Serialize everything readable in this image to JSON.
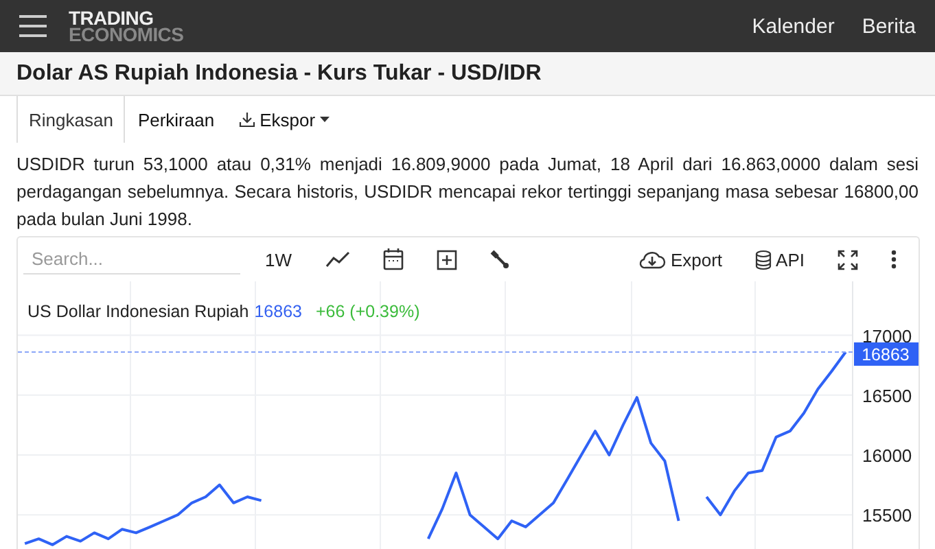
{
  "nav": {
    "logo_top": "TRADING",
    "logo_bottom": "ECONOMICS",
    "links": [
      "Kalender",
      "Berita"
    ]
  },
  "page_title": "Dolar AS Rupiah Indonesia - Kurs Tukar - USD/IDR",
  "tabs": [
    {
      "label": "Ringkasan",
      "selected": true,
      "kind": "plain"
    },
    {
      "label": "Perkiraan",
      "selected": false,
      "kind": "plain"
    },
    {
      "label": "Ekspor",
      "selected": false,
      "kind": "export"
    }
  ],
  "summary": "USDIDR turun 53,1000 atau 0,31% menjadi 16.809,9000 pada Jumat, 18 April dari 16.863,0000 dalam sesi perdagangan sebelumnya. Secara historis, USDIDR mencapai rekor tertinggi sepanjang masa sebesar 16800,00 pada bulan Juni 1998.",
  "chart": {
    "search": {
      "placeholder": "Search..."
    },
    "range": "1W",
    "export_label": "Export",
    "api_label": "API",
    "legend": {
      "value": "16863",
      "change": "+66 (+0.39%)"
    },
    "price_tag": "16863",
    "chart_data": {
      "type": "line",
      "ylim": [
        15215,
        17450
      ],
      "yticks": [
        15500,
        16000,
        16500,
        17000
      ],
      "grid": true,
      "series": [
        {
          "name": "US Dollar Indonesian Rupiah",
          "color": "#2f62f5",
          "values": [
            15260,
            15300,
            15250,
            15320,
            15280,
            15350,
            15300,
            15380,
            15350,
            15400,
            15450,
            15500,
            15600,
            15650,
            15750,
            15600,
            15650,
            15620,
            null,
            null,
            null,
            null,
            null,
            null,
            null,
            null,
            null,
            null,
            null,
            15300,
            15550,
            15850,
            15500,
            15400,
            15300,
            15450,
            15400,
            15500,
            15600,
            15800,
            16000,
            16200,
            16000,
            16250,
            16480,
            16100,
            15950,
            15450,
            null,
            15650,
            15500,
            15700,
            15850,
            15870,
            16150,
            16200,
            16350,
            16550,
            16700,
            16860
          ]
        }
      ]
    }
  }
}
